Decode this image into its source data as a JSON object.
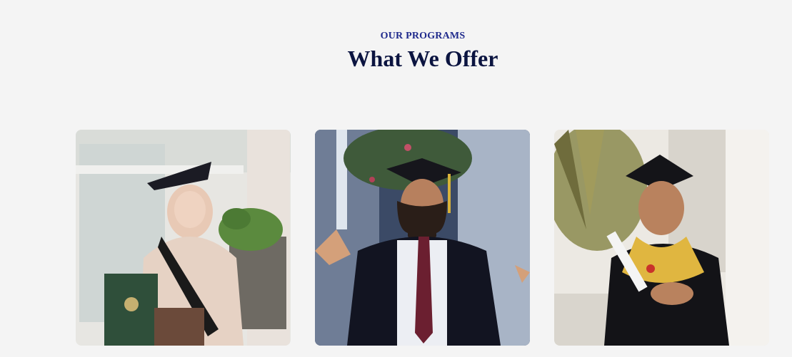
{
  "section": {
    "eyebrow": "OUR PROGRAMS",
    "title": "What We Offer"
  },
  "cards": [
    {
      "image": "graduate-woman-hijab-photo",
      "accent": "#2f4f3a"
    },
    {
      "image": "graduate-man-cap-photo",
      "accent": "#1c1f3a"
    },
    {
      "image": "graduate-man-diploma-photo",
      "accent": "#e0b640"
    }
  ],
  "colors": {
    "background": "#f4f4f4",
    "eyebrow": "#1f2a8c",
    "title": "#0b1440"
  }
}
